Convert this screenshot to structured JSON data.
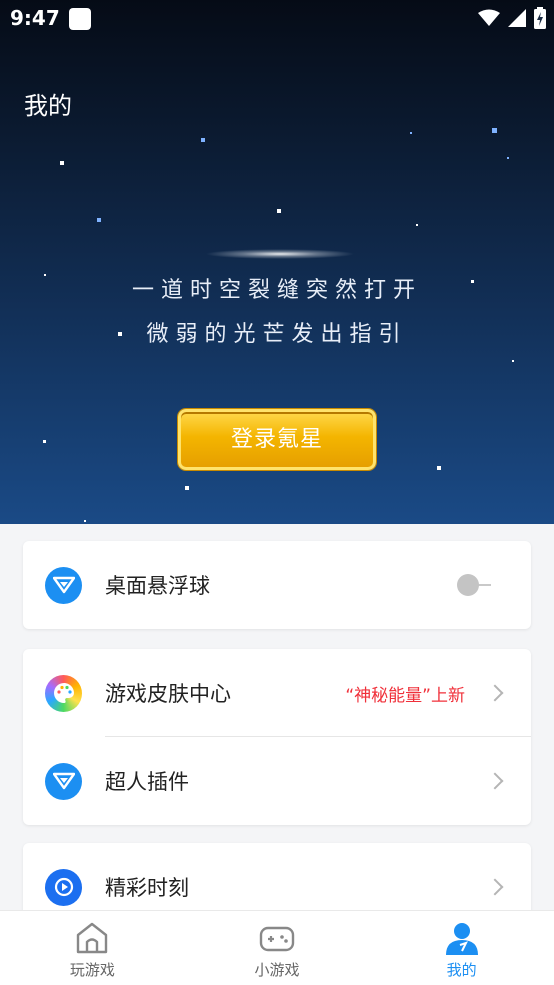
{
  "status_bar": {
    "time": "9:47"
  },
  "header": {
    "title": "我的",
    "tagline_line1": "一道时空裂缝突然打开",
    "tagline_line2": "微弱的光芒发出指引",
    "login_label": "登录氪星"
  },
  "settings": {
    "floating_ball": {
      "label": "桌面悬浮球",
      "enabled": false
    },
    "skin_center": {
      "label": "游戏皮肤中心",
      "promo": "“神秘能量”上新"
    },
    "superman_plugin": {
      "label": "超人插件"
    },
    "highlights": {
      "label": "精彩时刻"
    }
  },
  "bottom_nav": {
    "items": [
      {
        "label": "玩游戏",
        "icon": "home-icon",
        "active": false
      },
      {
        "label": "小游戏",
        "icon": "gamepad-icon",
        "active": false
      },
      {
        "label": "我的",
        "icon": "user-icon",
        "active": true
      }
    ]
  },
  "colors": {
    "accent": "#1c8ff2",
    "promo": "#f0303a",
    "login_button": "#f4b500"
  }
}
